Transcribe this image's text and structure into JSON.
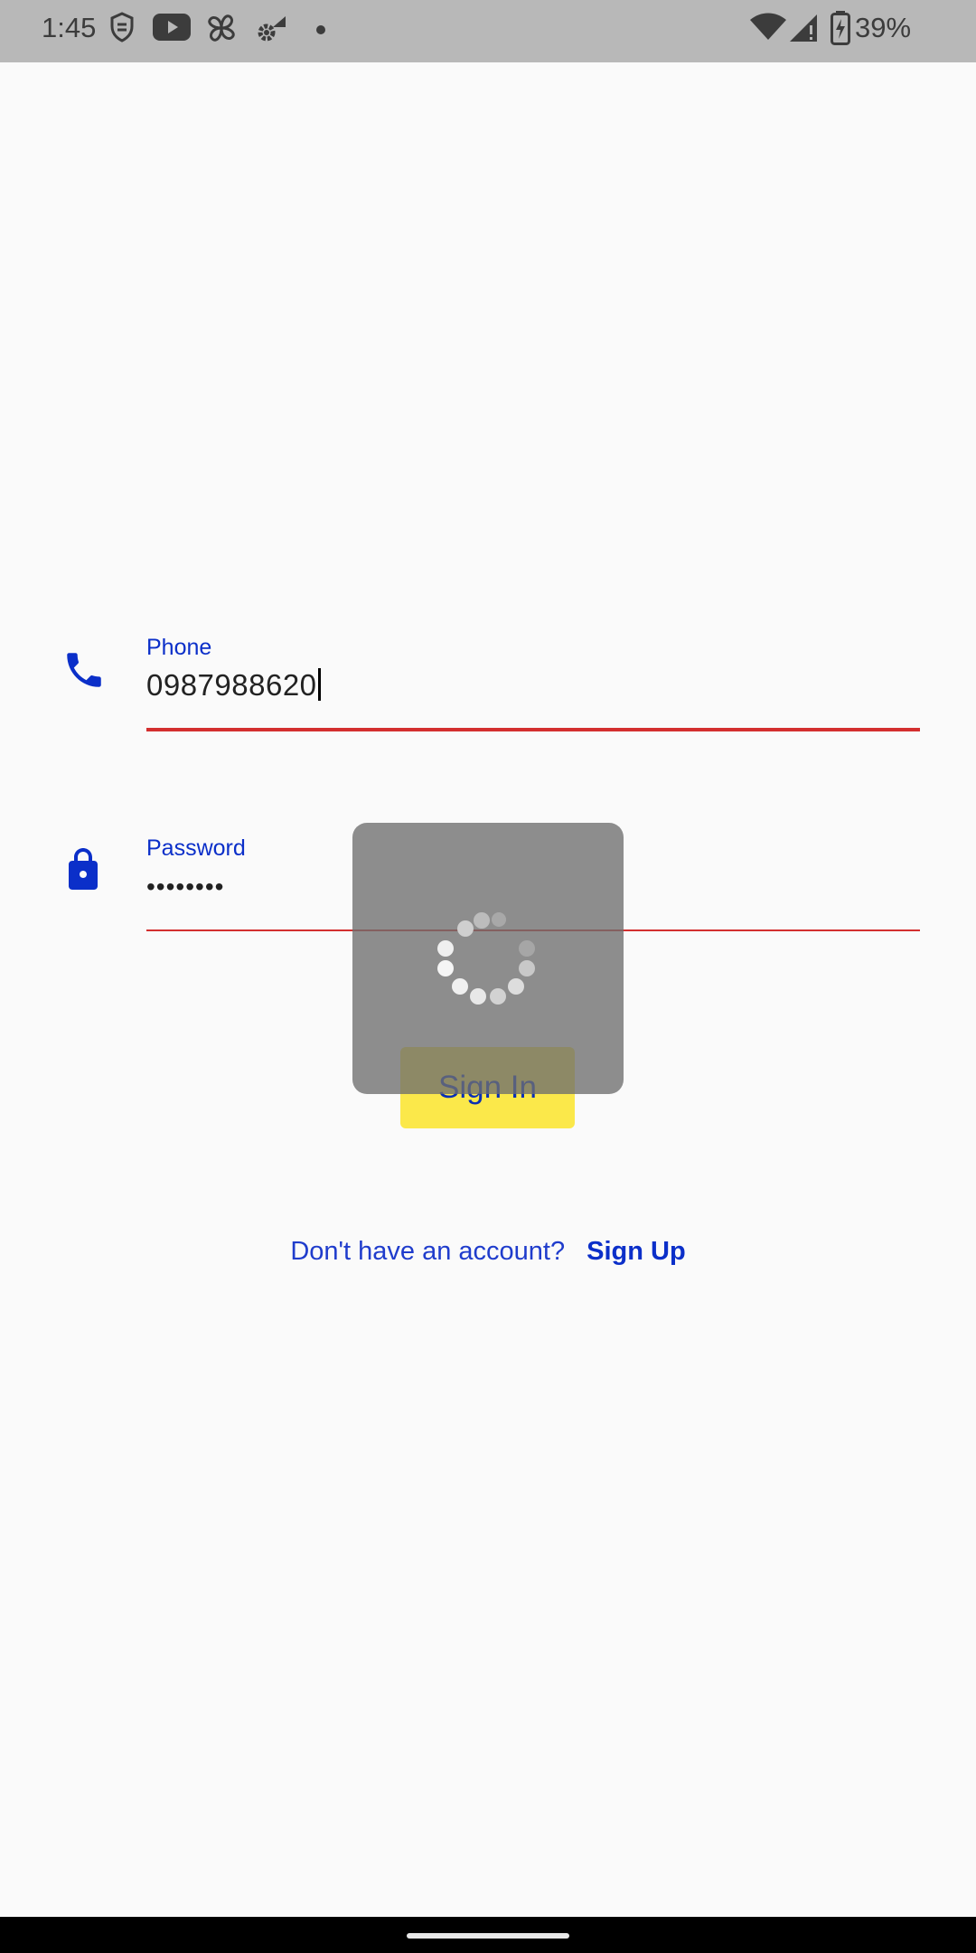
{
  "status_bar": {
    "time": "1:45",
    "battery": "39%",
    "icons": [
      "vpn-icon",
      "youtube-icon",
      "pinwheel-icon",
      "settings-icon",
      "dot-icon",
      "wifi-icon",
      "signal-icon",
      "battery-charging-icon"
    ]
  },
  "form": {
    "phone": {
      "label": "Phone",
      "value": "0987988620",
      "icon": "phone-icon",
      "focused": true
    },
    "password": {
      "label": "Password",
      "value": "••••••••",
      "icon": "lock-icon"
    },
    "sign_in_label": "Sign In"
  },
  "loading": {
    "visible": true,
    "icon": "spinner-icon"
  },
  "footer": {
    "prompt": "Don't have an account?",
    "sign_up_label": "Sign Up"
  },
  "colors": {
    "accent": "#0b2fc9",
    "error_underline": "#d32f2f",
    "button_bg": "#fbe84a",
    "overlay": "#6e6e6e"
  }
}
